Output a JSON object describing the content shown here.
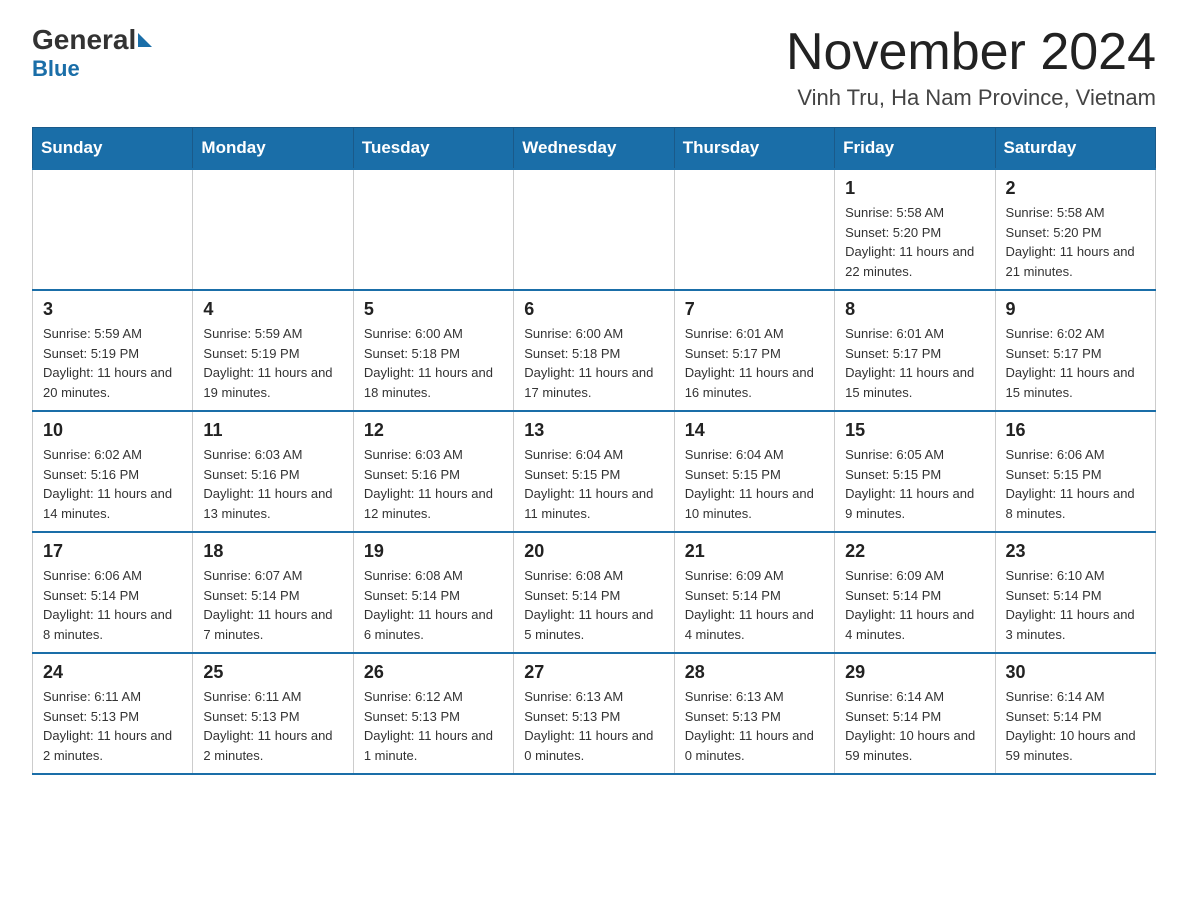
{
  "logo": {
    "general": "General",
    "blue": "Blue",
    "sub": "Blue"
  },
  "title": "November 2024",
  "subtitle": "Vinh Tru, Ha Nam Province, Vietnam",
  "days_of_week": [
    "Sunday",
    "Monday",
    "Tuesday",
    "Wednesday",
    "Thursday",
    "Friday",
    "Saturday"
  ],
  "weeks": [
    [
      {
        "day": "",
        "sunrise": "",
        "sunset": "",
        "daylight": ""
      },
      {
        "day": "",
        "sunrise": "",
        "sunset": "",
        "daylight": ""
      },
      {
        "day": "",
        "sunrise": "",
        "sunset": "",
        "daylight": ""
      },
      {
        "day": "",
        "sunrise": "",
        "sunset": "",
        "daylight": ""
      },
      {
        "day": "",
        "sunrise": "",
        "sunset": "",
        "daylight": ""
      },
      {
        "day": "1",
        "sunrise": "Sunrise: 5:58 AM",
        "sunset": "Sunset: 5:20 PM",
        "daylight": "Daylight: 11 hours and 22 minutes."
      },
      {
        "day": "2",
        "sunrise": "Sunrise: 5:58 AM",
        "sunset": "Sunset: 5:20 PM",
        "daylight": "Daylight: 11 hours and 21 minutes."
      }
    ],
    [
      {
        "day": "3",
        "sunrise": "Sunrise: 5:59 AM",
        "sunset": "Sunset: 5:19 PM",
        "daylight": "Daylight: 11 hours and 20 minutes."
      },
      {
        "day": "4",
        "sunrise": "Sunrise: 5:59 AM",
        "sunset": "Sunset: 5:19 PM",
        "daylight": "Daylight: 11 hours and 19 minutes."
      },
      {
        "day": "5",
        "sunrise": "Sunrise: 6:00 AM",
        "sunset": "Sunset: 5:18 PM",
        "daylight": "Daylight: 11 hours and 18 minutes."
      },
      {
        "day": "6",
        "sunrise": "Sunrise: 6:00 AM",
        "sunset": "Sunset: 5:18 PM",
        "daylight": "Daylight: 11 hours and 17 minutes."
      },
      {
        "day": "7",
        "sunrise": "Sunrise: 6:01 AM",
        "sunset": "Sunset: 5:17 PM",
        "daylight": "Daylight: 11 hours and 16 minutes."
      },
      {
        "day": "8",
        "sunrise": "Sunrise: 6:01 AM",
        "sunset": "Sunset: 5:17 PM",
        "daylight": "Daylight: 11 hours and 15 minutes."
      },
      {
        "day": "9",
        "sunrise": "Sunrise: 6:02 AM",
        "sunset": "Sunset: 5:17 PM",
        "daylight": "Daylight: 11 hours and 15 minutes."
      }
    ],
    [
      {
        "day": "10",
        "sunrise": "Sunrise: 6:02 AM",
        "sunset": "Sunset: 5:16 PM",
        "daylight": "Daylight: 11 hours and 14 minutes."
      },
      {
        "day": "11",
        "sunrise": "Sunrise: 6:03 AM",
        "sunset": "Sunset: 5:16 PM",
        "daylight": "Daylight: 11 hours and 13 minutes."
      },
      {
        "day": "12",
        "sunrise": "Sunrise: 6:03 AM",
        "sunset": "Sunset: 5:16 PM",
        "daylight": "Daylight: 11 hours and 12 minutes."
      },
      {
        "day": "13",
        "sunrise": "Sunrise: 6:04 AM",
        "sunset": "Sunset: 5:15 PM",
        "daylight": "Daylight: 11 hours and 11 minutes."
      },
      {
        "day": "14",
        "sunrise": "Sunrise: 6:04 AM",
        "sunset": "Sunset: 5:15 PM",
        "daylight": "Daylight: 11 hours and 10 minutes."
      },
      {
        "day": "15",
        "sunrise": "Sunrise: 6:05 AM",
        "sunset": "Sunset: 5:15 PM",
        "daylight": "Daylight: 11 hours and 9 minutes."
      },
      {
        "day": "16",
        "sunrise": "Sunrise: 6:06 AM",
        "sunset": "Sunset: 5:15 PM",
        "daylight": "Daylight: 11 hours and 8 minutes."
      }
    ],
    [
      {
        "day": "17",
        "sunrise": "Sunrise: 6:06 AM",
        "sunset": "Sunset: 5:14 PM",
        "daylight": "Daylight: 11 hours and 8 minutes."
      },
      {
        "day": "18",
        "sunrise": "Sunrise: 6:07 AM",
        "sunset": "Sunset: 5:14 PM",
        "daylight": "Daylight: 11 hours and 7 minutes."
      },
      {
        "day": "19",
        "sunrise": "Sunrise: 6:08 AM",
        "sunset": "Sunset: 5:14 PM",
        "daylight": "Daylight: 11 hours and 6 minutes."
      },
      {
        "day": "20",
        "sunrise": "Sunrise: 6:08 AM",
        "sunset": "Sunset: 5:14 PM",
        "daylight": "Daylight: 11 hours and 5 minutes."
      },
      {
        "day": "21",
        "sunrise": "Sunrise: 6:09 AM",
        "sunset": "Sunset: 5:14 PM",
        "daylight": "Daylight: 11 hours and 4 minutes."
      },
      {
        "day": "22",
        "sunrise": "Sunrise: 6:09 AM",
        "sunset": "Sunset: 5:14 PM",
        "daylight": "Daylight: 11 hours and 4 minutes."
      },
      {
        "day": "23",
        "sunrise": "Sunrise: 6:10 AM",
        "sunset": "Sunset: 5:14 PM",
        "daylight": "Daylight: 11 hours and 3 minutes."
      }
    ],
    [
      {
        "day": "24",
        "sunrise": "Sunrise: 6:11 AM",
        "sunset": "Sunset: 5:13 PM",
        "daylight": "Daylight: 11 hours and 2 minutes."
      },
      {
        "day": "25",
        "sunrise": "Sunrise: 6:11 AM",
        "sunset": "Sunset: 5:13 PM",
        "daylight": "Daylight: 11 hours and 2 minutes."
      },
      {
        "day": "26",
        "sunrise": "Sunrise: 6:12 AM",
        "sunset": "Sunset: 5:13 PM",
        "daylight": "Daylight: 11 hours and 1 minute."
      },
      {
        "day": "27",
        "sunrise": "Sunrise: 6:13 AM",
        "sunset": "Sunset: 5:13 PM",
        "daylight": "Daylight: 11 hours and 0 minutes."
      },
      {
        "day": "28",
        "sunrise": "Sunrise: 6:13 AM",
        "sunset": "Sunset: 5:13 PM",
        "daylight": "Daylight: 11 hours and 0 minutes."
      },
      {
        "day": "29",
        "sunrise": "Sunrise: 6:14 AM",
        "sunset": "Sunset: 5:14 PM",
        "daylight": "Daylight: 10 hours and 59 minutes."
      },
      {
        "day": "30",
        "sunrise": "Sunrise: 6:14 AM",
        "sunset": "Sunset: 5:14 PM",
        "daylight": "Daylight: 10 hours and 59 minutes."
      }
    ]
  ]
}
